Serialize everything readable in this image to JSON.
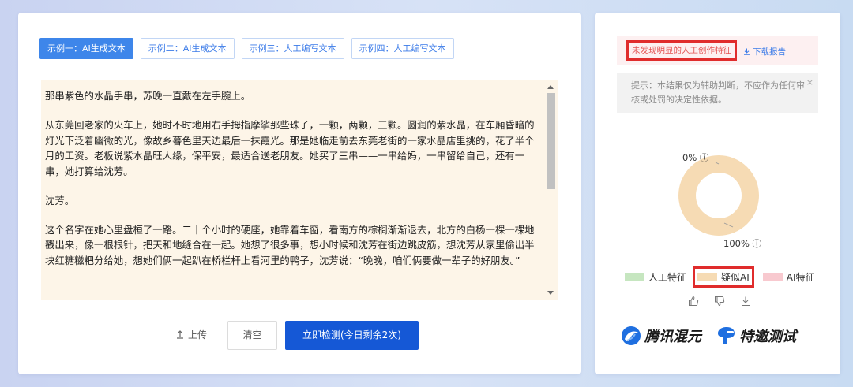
{
  "tabs": [
    {
      "label": "示例一：AI生成文本",
      "active": true
    },
    {
      "label": "示例二：AI生成文本",
      "active": false
    },
    {
      "label": "示例三：人工编写文本",
      "active": false
    },
    {
      "label": "示例四：人工编写文本",
      "active": false
    }
  ],
  "text": {
    "paragraphs": [
      "那串紫色的水晶手串，苏晚一直戴在左手腕上。",
      "从东莞回老家的火车上，她时不时地用右手拇指摩挲那些珠子，一颗，两颗，三颗。圆润的紫水晶，在车厢昏暗的灯光下泛着幽微的光，像故乡暮色里天边最后一抹霞光。那是她临走前去东莞老街的一家水晶店里挑的，花了半个月的工资。老板说紫水晶旺人缘，保平安，最适合送老朋友。她买了三串——一串给妈，一串留给自己，还有一串，她打算给沈芳。",
      "沈芳。",
      "这个名字在她心里盘桓了一路。二十个小时的硬座，她靠着车窗，看南方的棕榈渐渐退去，北方的白杨一棵一棵地戳出来，像一根根针，把天和地缝合在一起。她想了很多事，想小时候和沈芳在街边跳皮筋，想沈芳从家里偷出半块红糖糍粑分给她，想她们俩一起趴在桥栏杆上看河里的鸭子，沈芳说：“晚晚，咱们俩要做一辈子的好朋友。”"
    ]
  },
  "buttons": {
    "upload": "上传",
    "clear": "清空",
    "detect": "立即检测(今日剩余2次)"
  },
  "result": {
    "label": "未发现明显的人工创作特征",
    "download": "下载报告",
    "hint": "提示：本结果仅为辅助判断，不应作为任何审核或处罚的决定性依据。",
    "hint_close": "×"
  },
  "chart_data": {
    "type": "pie",
    "donut": true,
    "slices": [
      {
        "name": "疑似AI",
        "value": 100,
        "color": "#f6dbb4"
      },
      {
        "name": "人工特征",
        "value": 0,
        "color": "#c6e6c0"
      }
    ],
    "labels": [
      "0% ⓘ",
      "100% ⓘ"
    ],
    "legend": [
      {
        "name": "人工特征",
        "color": "#c6e6c0"
      },
      {
        "name": "疑似AI",
        "color": "#f6dbb4"
      },
      {
        "name": "AI特征",
        "color": "#f8c9cf"
      }
    ]
  },
  "brand": {
    "name1": "腾讯混元",
    "name2": "特邀测试"
  },
  "icons": {
    "upload": "upload-icon",
    "download": "download-icon",
    "thumbs_up": "thumbs-up-icon",
    "thumbs_down": "thumbs-down-icon",
    "share": "download-arrow-icon"
  }
}
